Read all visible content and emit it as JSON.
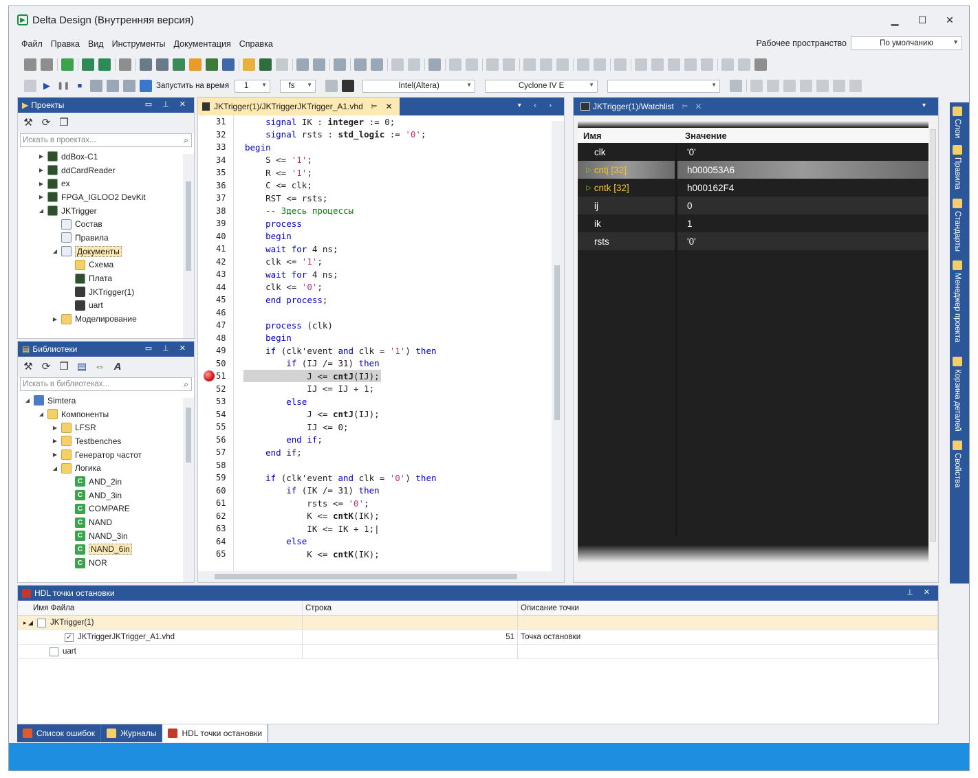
{
  "window": {
    "title": "Delta Design (Внутренняя версия)",
    "minimize": "▁",
    "maximize": "☐",
    "close": "✕"
  },
  "menu": {
    "items": [
      "Файл",
      "Правка",
      "Вид",
      "Инструменты",
      "Документация",
      "Справка"
    ],
    "workspace_label": "Рабочее пространство",
    "workspace_value": "По умолчанию"
  },
  "toolbar2": {
    "run_to_time": "Запустить на время",
    "time_value": "1",
    "time_unit": "fs",
    "vendor": "Intel(Altera)",
    "device": "Cyclone IV E",
    "extra": ""
  },
  "projects": {
    "title": "Проекты",
    "search_placeholder": "Искать в проектах...",
    "items": [
      {
        "label": "ddBox-C1",
        "indent": 1,
        "arrow": "▶",
        "icon": "board"
      },
      {
        "label": "ddCardReader",
        "indent": 1,
        "arrow": "▶",
        "icon": "board"
      },
      {
        "label": "ex",
        "indent": 1,
        "arrow": "▶",
        "icon": "board"
      },
      {
        "label": "FPGA_IGLOO2 DevKit",
        "indent": 1,
        "arrow": "▶",
        "icon": "board"
      },
      {
        "label": "JKTrigger",
        "indent": 1,
        "arrow": "◢",
        "icon": "board"
      },
      {
        "label": "Состав",
        "indent": 2,
        "arrow": "",
        "icon": "doc"
      },
      {
        "label": "Правила",
        "indent": 2,
        "arrow": "",
        "icon": "doc"
      },
      {
        "label": "Документы",
        "indent": 2,
        "arrow": "◢",
        "icon": "doc",
        "selected": true
      },
      {
        "label": "Схема",
        "indent": 3,
        "arrow": "",
        "icon": "folder"
      },
      {
        "label": "Плата",
        "indent": 3,
        "arrow": "",
        "icon": "board"
      },
      {
        "label": "JKTrigger(1)",
        "indent": 3,
        "arrow": "",
        "icon": "chip"
      },
      {
        "label": "uart",
        "indent": 3,
        "arrow": "",
        "icon": "chip"
      },
      {
        "label": "Моделирование",
        "indent": 2,
        "arrow": "▶",
        "icon": "folder"
      }
    ]
  },
  "libraries": {
    "title": "Библиотеки",
    "search_placeholder": "Искать в библиотеках...",
    "items": [
      {
        "label": "Simtera",
        "indent": 0,
        "arrow": "◢",
        "icon": "lib"
      },
      {
        "label": "Компоненты",
        "indent": 1,
        "arrow": "◢",
        "icon": "folder"
      },
      {
        "label": "LFSR",
        "indent": 2,
        "arrow": "▶",
        "icon": "folder"
      },
      {
        "label": "Testbenches",
        "indent": 2,
        "arrow": "▶",
        "icon": "folder"
      },
      {
        "label": "Генератор частот",
        "indent": 2,
        "arrow": "▶",
        "icon": "folder"
      },
      {
        "label": "Логика",
        "indent": 2,
        "arrow": "◢",
        "icon": "folder"
      },
      {
        "label": "AND_2in",
        "indent": 3,
        "arrow": "",
        "icon": "comp"
      },
      {
        "label": "AND_3in",
        "indent": 3,
        "arrow": "",
        "icon": "comp"
      },
      {
        "label": "COMPARE",
        "indent": 3,
        "arrow": "",
        "icon": "comp"
      },
      {
        "label": "NAND",
        "indent": 3,
        "arrow": "",
        "icon": "comp"
      },
      {
        "label": "NAND_3in",
        "indent": 3,
        "arrow": "",
        "icon": "comp"
      },
      {
        "label": "NAND_6in",
        "indent": 3,
        "arrow": "",
        "icon": "comp",
        "selected": true
      },
      {
        "label": "NOR",
        "indent": 3,
        "arrow": "",
        "icon": "comp"
      }
    ]
  },
  "editor": {
    "tab_title": "JKTrigger(1)/JKTriggerJKTrigger_A1.vhd",
    "breakpoint_line": "51",
    "lines": [
      {
        "n": "31",
        "html": "    <span class=\"kw\">signal</span> IK : <b>integer</b> := 0;"
      },
      {
        "n": "32",
        "html": "    <span class=\"kw\">signal</span> rsts : <b>std_logic</b> := <span class=\"str\">'0'</span>;"
      },
      {
        "n": "33",
        "html": "<span class=\"kw\">begin</span>"
      },
      {
        "n": "34",
        "html": "    S &lt;= <span class=\"str\">'1'</span>;"
      },
      {
        "n": "35",
        "html": "    R &lt;= <span class=\"str\">'1'</span>;"
      },
      {
        "n": "36",
        "html": "    C &lt;= clk;"
      },
      {
        "n": "37",
        "html": "    RST &lt;= rsts;"
      },
      {
        "n": "38",
        "html": "    <span class=\"cmt\">-- Здесь процессы</span>"
      },
      {
        "n": "39",
        "html": "    <span class=\"kw\">process</span>"
      },
      {
        "n": "40",
        "html": "    <span class=\"kw\">begin</span>"
      },
      {
        "n": "41",
        "html": "    <span class=\"kw\">wait for</span> 4 ns;"
      },
      {
        "n": "42",
        "html": "    clk &lt;= <span class=\"str\">'1'</span>;"
      },
      {
        "n": "43",
        "html": "    <span class=\"kw\">wait for</span> 4 ns;"
      },
      {
        "n": "44",
        "html": "    clk &lt;= <span class=\"str\">'0'</span>;"
      },
      {
        "n": "45",
        "html": "    <span class=\"kw\">end process</span>;"
      },
      {
        "n": "46",
        "html": ""
      },
      {
        "n": "47",
        "html": "    <span class=\"kw\">process</span> (clk)"
      },
      {
        "n": "48",
        "html": "    <span class=\"kw\">begin</span>"
      },
      {
        "n": "49",
        "html": "    <span class=\"kw\">if</span> (clk'event <span class=\"kw\">and</span> clk = <span class=\"str\">'1'</span>) <span class=\"kw\">then</span>"
      },
      {
        "n": "50",
        "html": "        <span class=\"kw\">if</span> (IJ /= 31) <span class=\"kw\">then</span>"
      },
      {
        "n": "51",
        "html": "            J &lt;= <b>cntJ</b>(IJ);",
        "hl": true
      },
      {
        "n": "52",
        "html": "            IJ &lt;= IJ + 1;"
      },
      {
        "n": "53",
        "html": "        <span class=\"kw\">else</span>"
      },
      {
        "n": "54",
        "html": "            J &lt;= <b>cntJ</b>(IJ);"
      },
      {
        "n": "55",
        "html": "            IJ &lt;= 0;"
      },
      {
        "n": "56",
        "html": "        <span class=\"kw\">end if</span>;"
      },
      {
        "n": "57",
        "html": "    <span class=\"kw\">end if</span>;"
      },
      {
        "n": "58",
        "html": ""
      },
      {
        "n": "59",
        "html": "    <span class=\"kw\">if</span> (clk'event <span class=\"kw\">and</span> clk = <span class=\"str\">'0'</span>) <span class=\"kw\">then</span>"
      },
      {
        "n": "60",
        "html": "        <span class=\"kw\">if</span> (IK /= 31) <span class=\"kw\">then</span>"
      },
      {
        "n": "61",
        "html": "            rsts &lt;= <span class=\"str\">'0'</span>;"
      },
      {
        "n": "62",
        "html": "            K &lt;= <b>cntK</b>(IK);"
      },
      {
        "n": "63",
        "html": "            IK &lt;= IK + 1;|"
      },
      {
        "n": "64",
        "html": "        <span class=\"kw\">else</span>"
      },
      {
        "n": "65",
        "html": "            K &lt;= <b>cntK</b>(IK);"
      }
    ]
  },
  "watchlist": {
    "tab_title": "JKTrigger(1)/Watchlist",
    "col_name": "Имя",
    "col_value": "Значение",
    "rows": [
      {
        "name": "clk",
        "value": "'0'",
        "style": ""
      },
      {
        "name": "cntj [32]",
        "value": "h000053A6",
        "style": "selected yellow",
        "expand": true
      },
      {
        "name": "cntk [32]",
        "value": "h000162F4",
        "style": "yellow",
        "expand": true
      },
      {
        "name": "ij",
        "value": "0",
        "style": "alt"
      },
      {
        "name": "ik",
        "value": "1",
        "style": ""
      },
      {
        "name": "rsts",
        "value": "'0'",
        "style": "alt"
      }
    ]
  },
  "sidedock": [
    "Слои",
    "Правила",
    "Стандарты",
    "Менеджер проекта",
    "Корзина деталей",
    "Свойства"
  ],
  "breakpoints": {
    "title": "HDL точки остановки",
    "col_file": "Имя Файла",
    "col_line": "Строка",
    "col_desc": "Описание точки",
    "rows": [
      {
        "file": "JKTrigger(1)",
        "line": "",
        "desc": "",
        "group": true,
        "checked": false
      },
      {
        "file": "JKTriggerJKTrigger_A1.vhd",
        "line": "51",
        "desc": "Точка остановки",
        "group": false,
        "checked": true
      },
      {
        "file": "uart",
        "line": "",
        "desc": "",
        "group": false,
        "checked": false
      }
    ]
  },
  "bottom_tabs": [
    "Список ошибок",
    "Журналы",
    "HDL точки остановки"
  ]
}
